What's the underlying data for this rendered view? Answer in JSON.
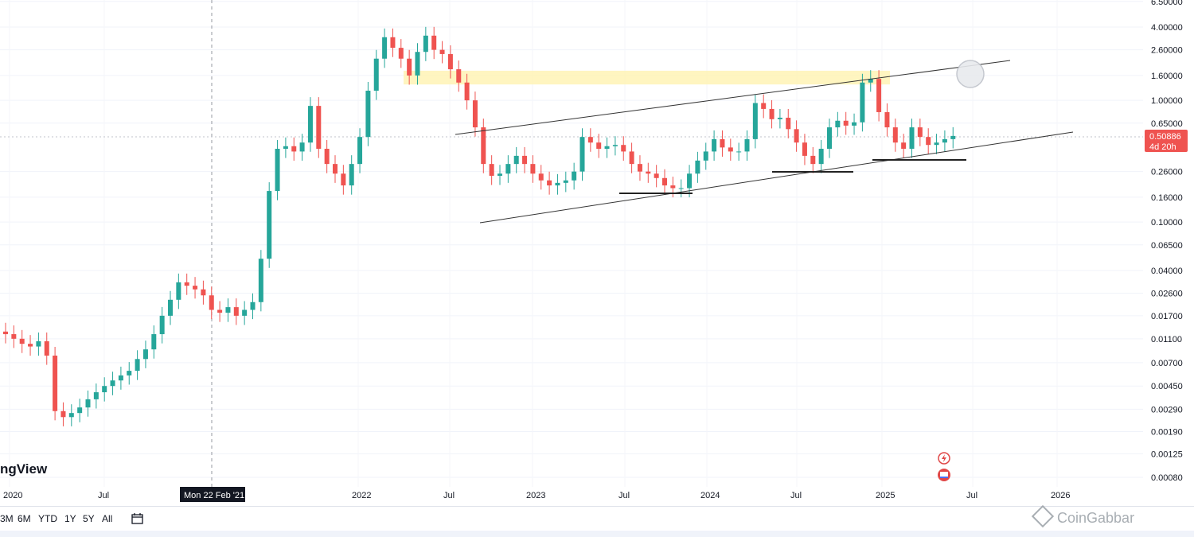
{
  "watermark": "ngView",
  "range_buttons": [
    "3M",
    "6M",
    "YTD",
    "1Y",
    "5Y",
    "All"
  ],
  "brand_text": "CoinGabbar",
  "colors": {
    "up": "#26a69a",
    "down": "#ef5350",
    "zone": "#fff3b0",
    "trendline": "#333333"
  },
  "icons": [
    "calendar-icon",
    "lightning-icon",
    "flag-icon"
  ],
  "chart_data": {
    "type": "candlestick",
    "scale": "log",
    "price_ticks": [
      "6.50000",
      "4.00000",
      "2.60000",
      "1.60000",
      "1.00000",
      "0.65000",
      "0.26000",
      "0.16000",
      "0.10000",
      "0.06500",
      "0.04000",
      "0.02600",
      "0.01700",
      "0.01100",
      "0.00700",
      "0.00450",
      "0.00290",
      "0.00190",
      "0.00125",
      "0.00080"
    ],
    "time_ticks": [
      "2020",
      "Jul",
      "2022",
      "Jul",
      "2023",
      "Jul",
      "2024",
      "Jul",
      "2025",
      "Jul",
      "2026"
    ],
    "crosshair_label": "Mon 22 Feb '21",
    "last_price": "0.50886",
    "countdown": "4d 20h",
    "closes": [
      0.012,
      0.011,
      0.01,
      0.0095,
      0.0105,
      0.008,
      0.0028,
      0.0025,
      0.0027,
      0.003,
      0.0035,
      0.004,
      0.0045,
      0.005,
      0.0055,
      0.006,
      0.0075,
      0.009,
      0.012,
      0.017,
      0.023,
      0.032,
      0.03,
      0.028,
      0.025,
      0.019,
      0.018,
      0.02,
      0.017,
      0.019,
      0.022,
      0.05,
      0.18,
      0.4,
      0.42,
      0.38,
      0.45,
      0.9,
      0.4,
      0.3,
      0.25,
      0.2,
      0.3,
      0.5,
      1.2,
      2.2,
      3.3,
      2.7,
      2.2,
      1.6,
      2.5,
      3.4,
      2.6,
      2.4,
      1.8,
      1.4,
      1.0,
      0.6,
      0.3,
      0.24,
      0.25,
      0.3,
      0.35,
      0.3,
      0.25,
      0.22,
      0.2,
      0.21,
      0.22,
      0.26,
      0.5,
      0.45,
      0.4,
      0.42,
      0.43,
      0.38,
      0.3,
      0.26,
      0.25,
      0.23,
      0.2,
      0.19,
      0.19,
      0.25,
      0.32,
      0.38,
      0.48,
      0.41,
      0.38,
      0.38,
      0.48,
      0.95,
      0.85,
      0.7,
      0.72,
      0.58,
      0.45,
      0.35,
      0.3,
      0.4,
      0.6,
      0.68,
      0.62,
      0.66,
      1.4,
      1.5,
      0.8,
      0.6,
      0.45,
      0.4,
      0.6,
      0.5,
      0.43,
      0.45,
      0.48,
      0.51
    ],
    "yellow_zone": {
      "price_low": 1.35,
      "price_high": 1.75,
      "from": "Apr 2022",
      "to": "Dec 2024"
    },
    "annotations": [
      "upper channel trendline",
      "lower channel trendline",
      "support lines",
      "circle target"
    ]
  }
}
